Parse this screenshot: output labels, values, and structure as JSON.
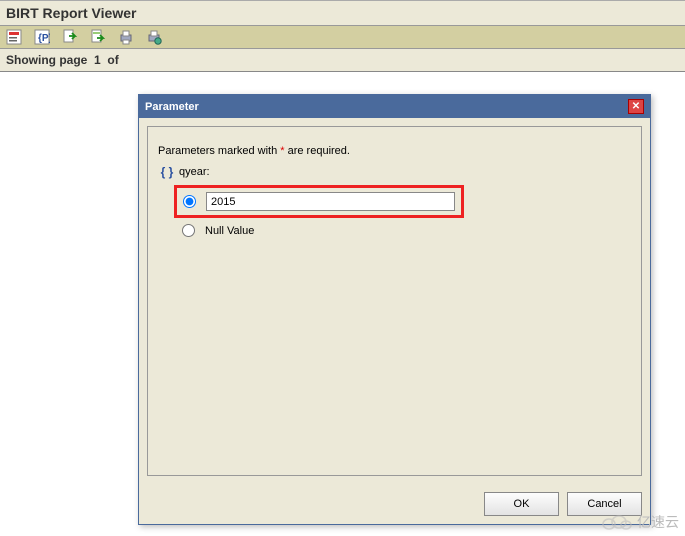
{
  "app": {
    "title": "BIRT Report Viewer"
  },
  "status": {
    "showing_prefix": "Showing page",
    "page": "1",
    "of": "of"
  },
  "toolbar": {
    "icons": [
      "toc-icon",
      "params-icon",
      "export-icon",
      "export-data-icon",
      "print-icon",
      "server-print-icon"
    ]
  },
  "dialog": {
    "title": "Parameter",
    "required_text_pre": "Parameters marked with ",
    "required_star": "*",
    "required_text_post": " are required.",
    "param_label": "qyear:",
    "input_value": "2015",
    "null_label": "Null Value",
    "ok": "OK",
    "cancel": "Cancel"
  },
  "watermark": {
    "text": "亿速云"
  }
}
